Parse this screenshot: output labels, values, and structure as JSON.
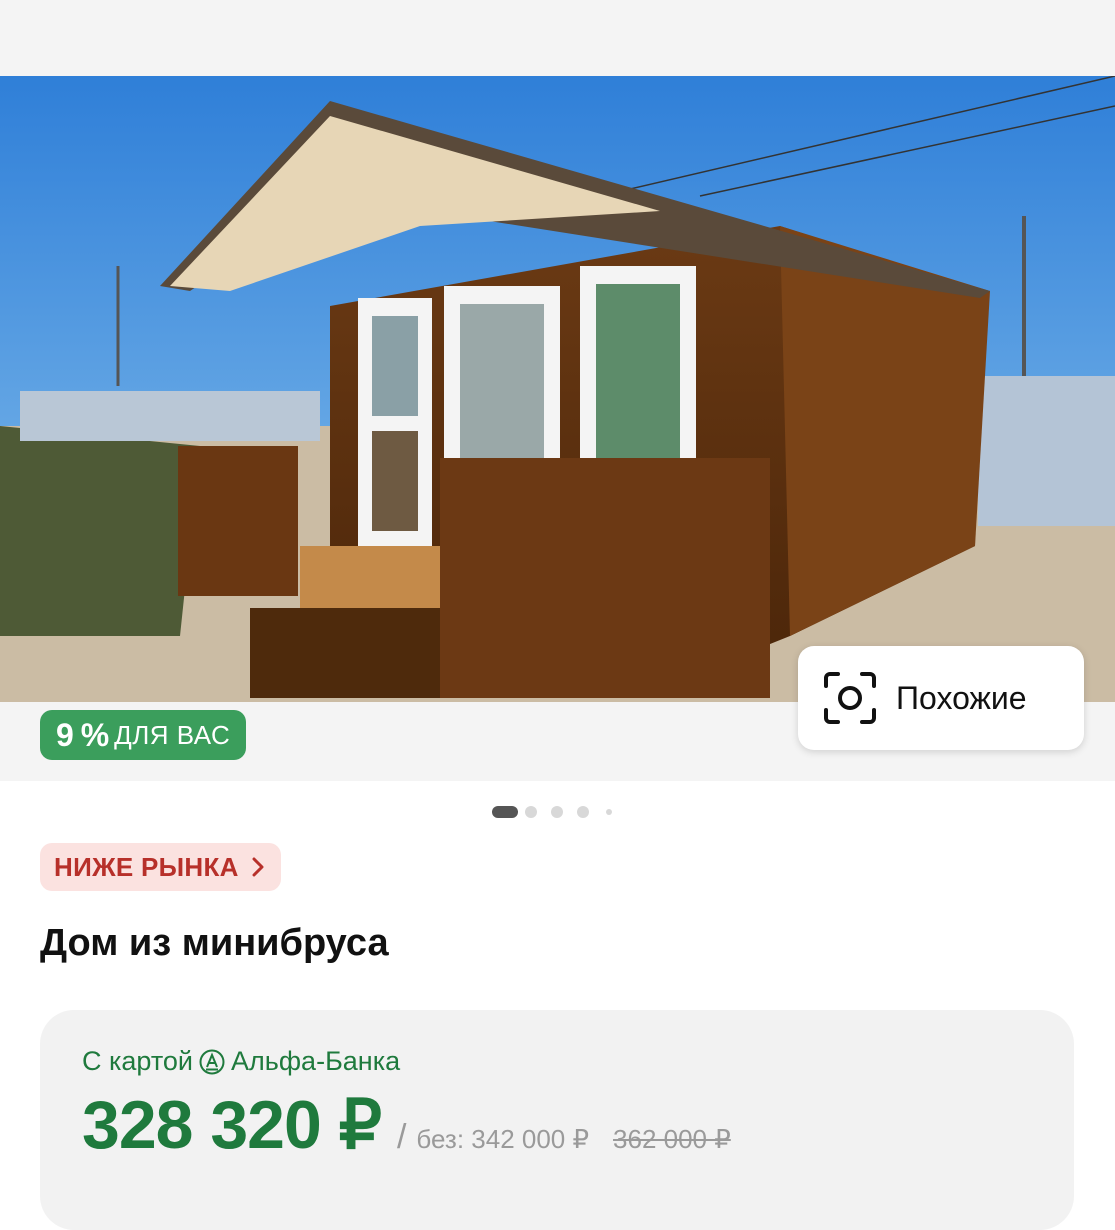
{
  "gallery": {
    "discount_badge": {
      "percent": "9 %",
      "text": "ДЛЯ ВАС"
    },
    "similar_button": {
      "label": "Похожие",
      "icon": "camera-search-icon"
    },
    "pagination": {
      "active_index": 0,
      "total": 5
    }
  },
  "listing": {
    "market_tag": "НИЖЕ РЫНКА",
    "title": "Дом из минибруса"
  },
  "price": {
    "card_prefix": "С картой",
    "bank_name": "Альфа-Банка",
    "bank_icon": "alfa-bank-icon",
    "card_price": "328 320 ₽",
    "separator": "/",
    "without_card": "без: 342 000 ₽",
    "old_price": "362 000 ₽"
  },
  "colors": {
    "accent_green": "#1f7a3d",
    "badge_green": "#3b9e5c",
    "tag_red": "#b7302a",
    "tag_bg": "#fbe2e0"
  }
}
